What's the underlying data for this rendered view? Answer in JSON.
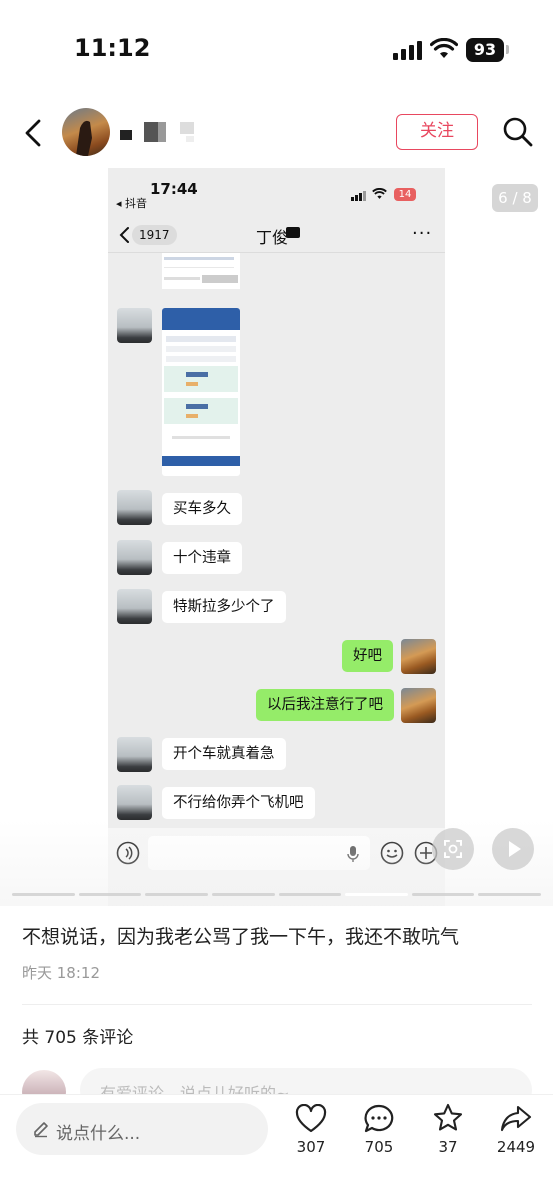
{
  "status_bar": {
    "time": "11:12",
    "battery": "93"
  },
  "header": {
    "username_masked": "■ ■ ■ ·",
    "follow_label": "关注"
  },
  "media": {
    "page_indicator": "6 / 8",
    "page_current": 6,
    "page_total": 8,
    "shot": {
      "status_time": "17:44",
      "back_app": "◂ 抖音",
      "battery": "14",
      "unread": "1917",
      "title": "丁俊"
    },
    "messages": [
      {
        "from": "them",
        "text": "买车多久"
      },
      {
        "from": "them",
        "text": "十个违章"
      },
      {
        "from": "them",
        "text": "特斯拉多少个了"
      },
      {
        "from": "me",
        "text": "好吧"
      },
      {
        "from": "me",
        "text": "以后我注意行了吧"
      },
      {
        "from": "them",
        "text": "开个车就真着急"
      },
      {
        "from": "them",
        "text": "不行给你弄个飞机吧"
      }
    ]
  },
  "post": {
    "caption": "不想说话，因为我老公骂了我一下午，我还不敢吭气",
    "time": "昨天 18:12",
    "comments_header": "共 705 条评论",
    "comment_placeholder": "有爱评论，说点儿好听的~"
  },
  "bottom_bar": {
    "input_label": "说点什么...",
    "likes": "307",
    "comments": "705",
    "favorites": "37",
    "shares": "2449"
  },
  "colors": {
    "accent": "#e8475f",
    "wechat_green": "#95ec69"
  }
}
